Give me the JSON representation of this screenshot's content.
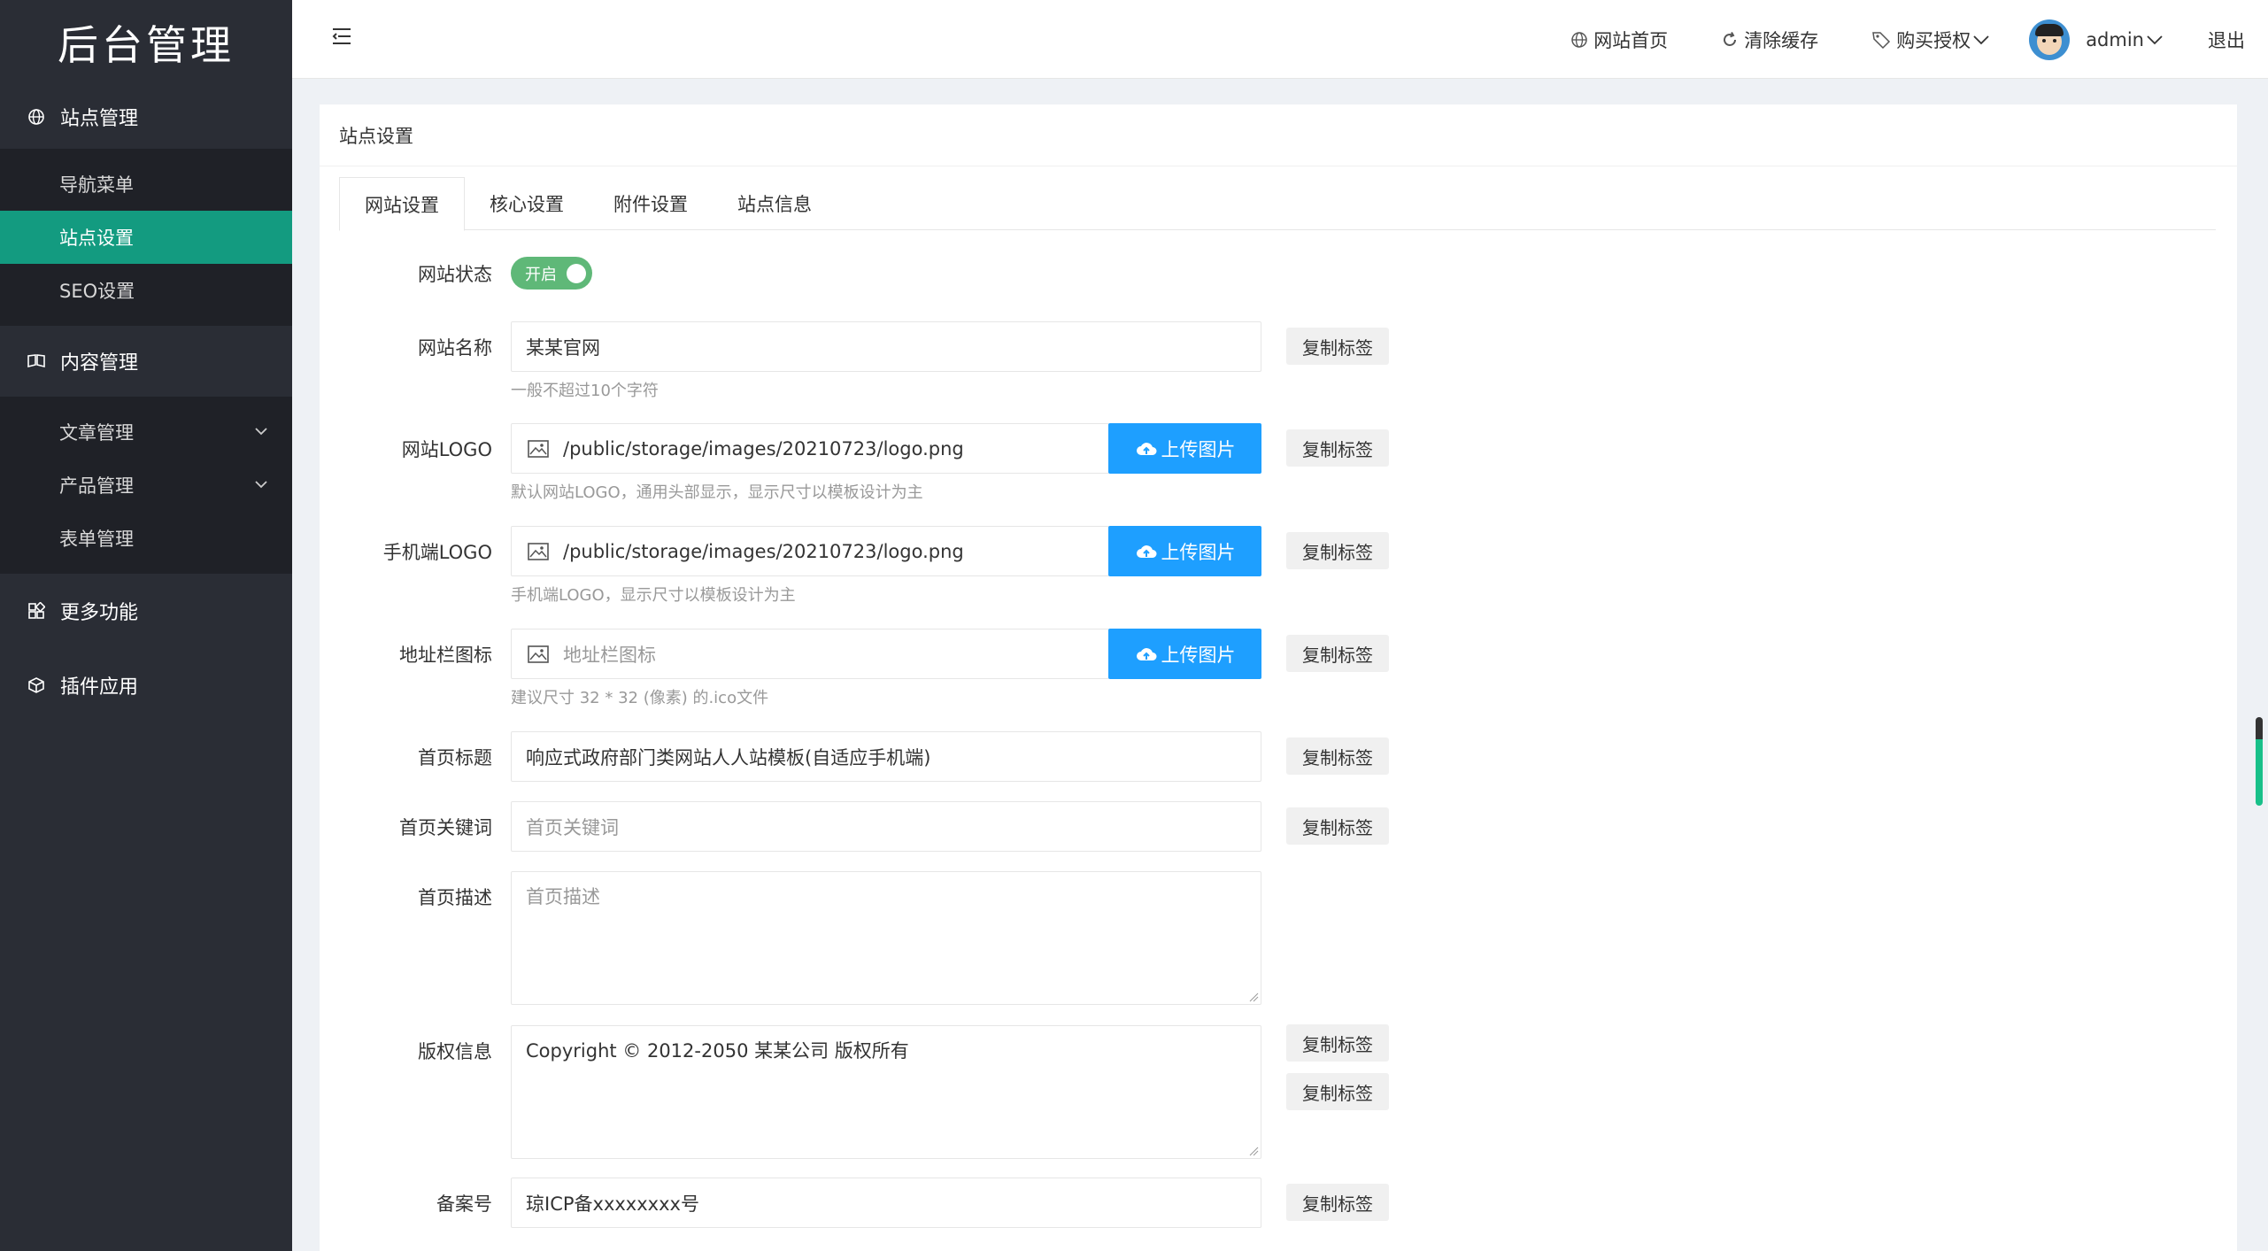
{
  "sidebar": {
    "logo": "后台管理",
    "groups": [
      {
        "label": "站点管理",
        "icon": "globe-icon"
      },
      {
        "label": "内容管理",
        "icon": "book-icon"
      },
      {
        "label": "更多功能",
        "icon": "apps-icon"
      },
      {
        "label": "插件应用",
        "icon": "cube-icon"
      }
    ],
    "site_items": [
      "导航菜单",
      "站点设置",
      "SEO设置"
    ],
    "content_items": [
      "文章管理",
      "产品管理",
      "表单管理"
    ]
  },
  "topbar": {
    "home": "网站首页",
    "clear_cache": "清除缓存",
    "buy_license": "购买授权",
    "user": "admin",
    "logout": "退出"
  },
  "card": {
    "title": "站点设置",
    "tabs": [
      "网站设置",
      "核心设置",
      "附件设置",
      "站点信息"
    ]
  },
  "form": {
    "status": {
      "label": "网站状态",
      "switch_text": "开启"
    },
    "name": {
      "label": "网站名称",
      "value": "某某官网",
      "hint": "一般不超过10个字符"
    },
    "logo": {
      "label": "网站LOGO",
      "value": "/public/storage/images/20210723/logo.png",
      "hint": "默认网站LOGO，通用头部显示，显示尺寸以模板设计为主"
    },
    "mobile_logo": {
      "label": "手机端LOGO",
      "value": "/public/storage/images/20210723/logo.png",
      "hint": "手机端LOGO，显示尺寸以模板设计为主"
    },
    "favicon": {
      "label": "地址栏图标",
      "placeholder": "地址栏图标",
      "hint": "建议尺寸 32 * 32 (像素) 的.ico文件"
    },
    "home_title": {
      "label": "首页标题",
      "value": "响应式政府部门类网站人人站模板(自适应手机端)"
    },
    "home_keywords": {
      "label": "首页关键词",
      "placeholder": "首页关键词"
    },
    "home_desc": {
      "label": "首页描述",
      "placeholder": "首页描述"
    },
    "copyright": {
      "label": "版权信息",
      "value": "Copyright © 2012-2050 某某公司 版权所有"
    },
    "icp": {
      "label": "备案号",
      "value": "琼ICP备xxxxxxxx号"
    },
    "upload_label": "上传图片",
    "copy_label": "复制标签"
  }
}
